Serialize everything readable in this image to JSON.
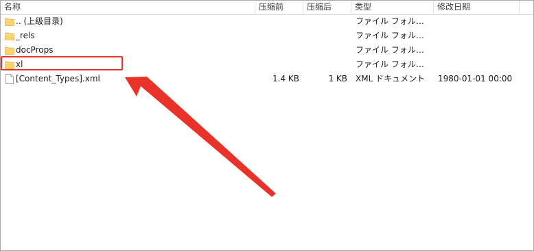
{
  "columns": {
    "name": "名称",
    "compressed": "压缩前",
    "compressed_after": "压缩后",
    "type": "类型",
    "modified": "修改日期"
  },
  "rows": [
    {
      "icon": "folder-icon",
      "name": ".. (上级目录)",
      "compressed": "",
      "compressed_after": "",
      "type": "ファイル フォル…",
      "modified": ""
    },
    {
      "icon": "folder-icon",
      "name": "_rels",
      "compressed": "",
      "compressed_after": "",
      "type": "ファイル フォル…",
      "modified": ""
    },
    {
      "icon": "folder-icon",
      "name": "docProps",
      "compressed": "",
      "compressed_after": "",
      "type": "ファイル フォル…",
      "modified": ""
    },
    {
      "icon": "folder-icon",
      "name": "xl",
      "compressed": "",
      "compressed_after": "",
      "type": "ファイル フォル…",
      "modified": ""
    },
    {
      "icon": "file-icon",
      "name": "[Content_Types].xml",
      "compressed": "1.4 KB",
      "compressed_after": "1 KB",
      "type": "XML ドキュメント",
      "modified": "1980-01-01 00:00"
    }
  ],
  "annotation": {
    "highlight_color": "#e8322a",
    "highlighted_row": "xl"
  }
}
